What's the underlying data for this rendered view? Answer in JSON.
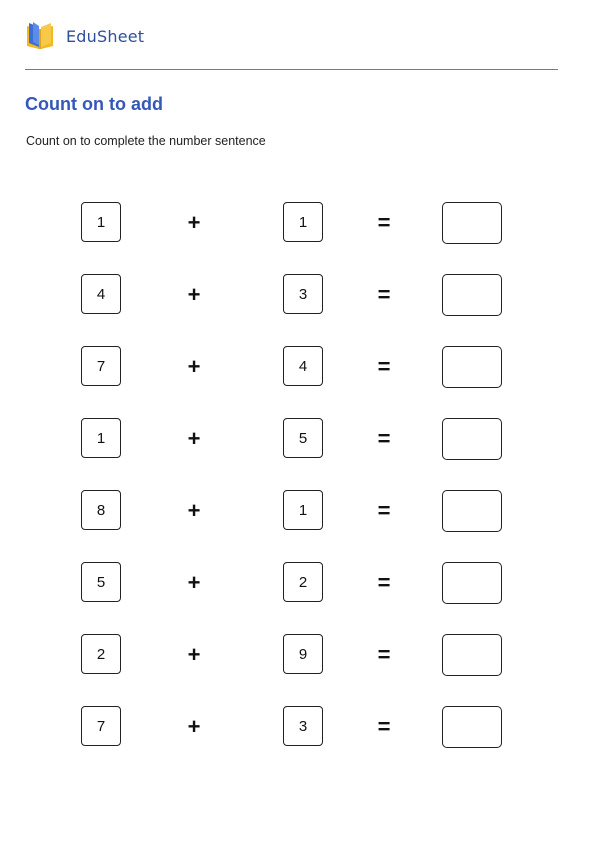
{
  "header": {
    "brand": "EduSheet",
    "logo_icon": "open-book-icon",
    "colors": {
      "brand": "#2f4f9e",
      "title": "#3558b8",
      "book_blue": "#3b6fd1",
      "book_yellow": "#f4b921"
    }
  },
  "worksheet": {
    "title": "Count on to add",
    "instructions": "Count on to complete the number sentence",
    "plus_symbol": "+",
    "equals_symbol": "=",
    "problems": [
      {
        "a": "1",
        "b": "1",
        "answer": ""
      },
      {
        "a": "4",
        "b": "3",
        "answer": ""
      },
      {
        "a": "7",
        "b": "4",
        "answer": ""
      },
      {
        "a": "1",
        "b": "5",
        "answer": ""
      },
      {
        "a": "8",
        "b": "1",
        "answer": ""
      },
      {
        "a": "5",
        "b": "2",
        "answer": ""
      },
      {
        "a": "2",
        "b": "9",
        "answer": ""
      },
      {
        "a": "7",
        "b": "3",
        "answer": ""
      }
    ]
  }
}
